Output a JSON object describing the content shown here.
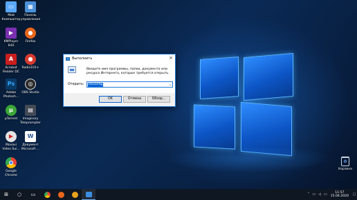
{
  "desktop": {
    "icons": [
      {
        "label": "Мой\nКомпьютер",
        "icon": "computer-icon",
        "color": "#5aa8ff"
      },
      {
        "label": "Панель\nуправления",
        "icon": "control-panel-icon",
        "color": "#4a90d9"
      },
      {
        "label": "KMPlayer\n64X",
        "icon": "kmplayer-icon",
        "color": "#7a2fb0"
      },
      {
        "label": "Firefox",
        "icon": "firefox-icon",
        "color": "#e8661c"
      },
      {
        "label": "Acrobat\nReader DC",
        "icon": "acrobat-icon",
        "color": "#c81e1e"
      },
      {
        "label": "Radio101+",
        "icon": "radio-icon",
        "color": "#d83a2e"
      },
      {
        "label": "Adobe\nPhotosh...",
        "icon": "photoshop-icon",
        "color": "#0b3a66"
      },
      {
        "label": "OBS Studio",
        "icon": "obs-icon",
        "color": "#2b2b2b"
      },
      {
        "label": "μTorrent",
        "icon": "utorrent-icon",
        "color": "#3aa636"
      },
      {
        "label": "Imaginary\nTeleprompter",
        "icon": "teleprompter-icon",
        "color": "#444a55"
      },
      {
        "label": "Movavi\nVideo Sui...",
        "icon": "movavi-icon",
        "color": "#e3e3e3"
      },
      {
        "label": "Документ\nMicrosoft ...",
        "icon": "word-document-icon",
        "color": "#ffffff"
      },
      {
        "label": "Google\nChrome",
        "icon": "chrome-icon",
        "color": "#34a853"
      }
    ],
    "recycle_bin": {
      "label": "Корзина",
      "icon": "recycle-bin-icon"
    }
  },
  "run_dialog": {
    "title": "Выполнить",
    "description": "Введите имя программы, папки, документа или ресурса Интернета, которые требуется открыть.",
    "open_label": "Открыть:",
    "input_value": "msconfig",
    "ok_label": "OK",
    "cancel_label": "Отмена",
    "browse_label": "Обзор...",
    "close_glyph": "×"
  },
  "taskbar": {
    "items": [
      {
        "name": "start-button",
        "icon": "windows-icon",
        "glyph": "⊞",
        "color": "#ffffff"
      },
      {
        "name": "search-button",
        "icon": "search-icon",
        "glyph": "○",
        "color": "#ffffff"
      },
      {
        "name": "taskbar-explorer",
        "icon": "task-view-icon",
        "glyph": "▭",
        "color": "#ffffff"
      },
      {
        "name": "taskbar-chrome",
        "icon": "chrome-icon",
        "glyph": "",
        "color": "#34a853"
      },
      {
        "name": "taskbar-firefox",
        "icon": "firefox-icon",
        "glyph": "",
        "color": "#e8661c"
      },
      {
        "name": "taskbar-yandex",
        "icon": "yandex-icon",
        "glyph": "",
        "color": "#e8a21c"
      },
      {
        "name": "taskbar-run",
        "icon": "run-icon",
        "glyph": "",
        "color": "#3a8de0"
      }
    ],
    "time": "11:57",
    "date": "15.04.2020"
  }
}
